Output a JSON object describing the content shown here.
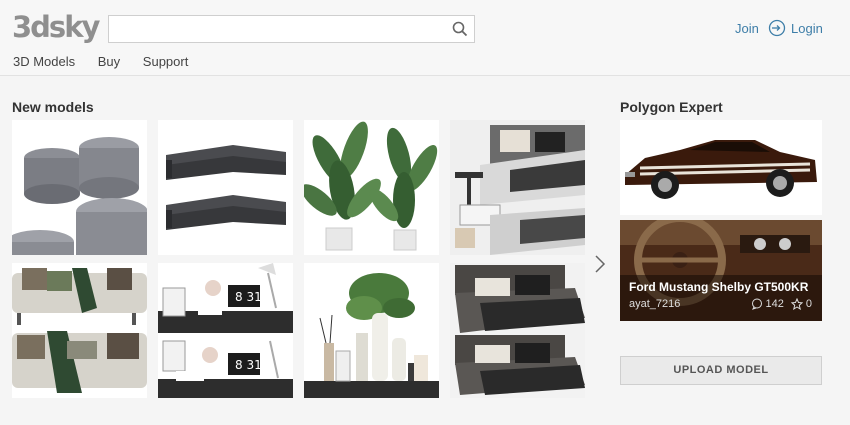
{
  "header": {
    "logo": "3dsky",
    "search": {
      "value": "",
      "placeholder": ""
    },
    "nav": [
      "3D Models",
      "Buy",
      "Support"
    ],
    "join": "Join",
    "login": "Login"
  },
  "new_models": {
    "title": "New models",
    "items": [
      {
        "name": "ottoman-poufs",
        "icon": "pouf-render"
      },
      {
        "name": "sectional-sofa",
        "icon": "sofa-render"
      },
      {
        "name": "banana-plants",
        "icon": "plant-render"
      },
      {
        "name": "bed-set",
        "icon": "bed-render"
      },
      {
        "name": "sofa-with-pillows",
        "icon": "sofa-render"
      },
      {
        "name": "desk-decor-set",
        "icon": "decor-render"
      },
      {
        "name": "bathroom-decor-set",
        "icon": "vase-render"
      },
      {
        "name": "dark-bed",
        "icon": "bed-render"
      }
    ]
  },
  "polygon_expert": {
    "title": "Polygon Expert",
    "model_name": "Ford Mustang Shelby GT500KR",
    "author": "ayat_7216",
    "comments": "142",
    "likes": "0"
  },
  "upload_label": "UPLOAD MODEL",
  "colors": {
    "accent": "#3e7ea8",
    "logo": "#8f8f8f",
    "background": "#f5f5f5"
  }
}
